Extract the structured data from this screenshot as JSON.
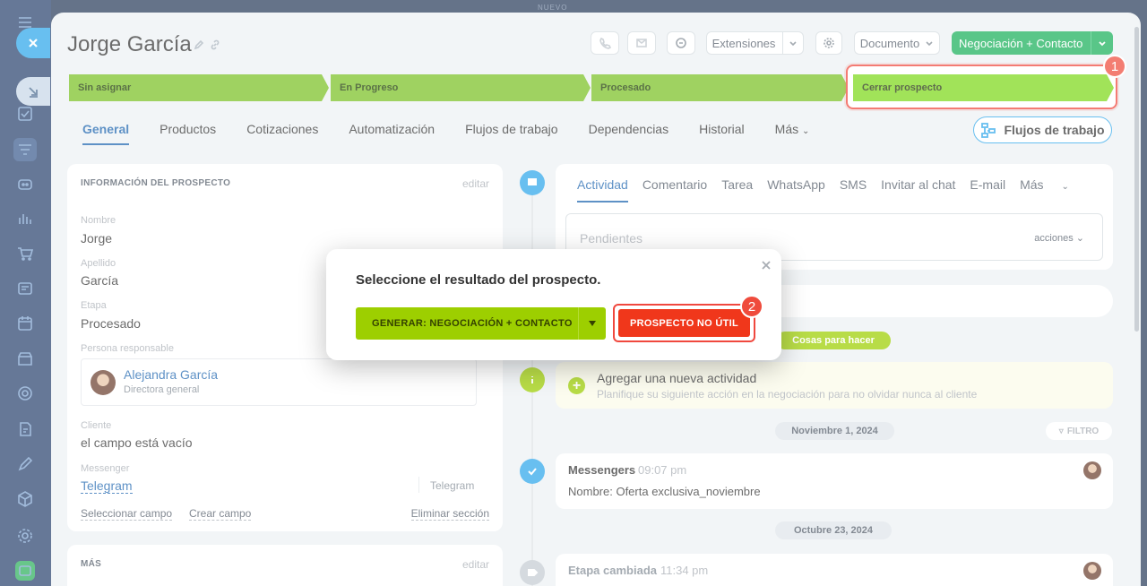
{
  "topbar": {
    "label": "NUEVO"
  },
  "header": {
    "title": "Jorge García",
    "extensions_label": "Extensiones",
    "document_label": "Documento",
    "primary_action_label": "Negociación + Contacto"
  },
  "stages": [
    {
      "label": "Sin asignar"
    },
    {
      "label": "En Progreso"
    },
    {
      "label": "Procesado"
    },
    {
      "label": "Cerrar prospecto"
    }
  ],
  "badges": {
    "one": "1",
    "two": "2"
  },
  "tabs": [
    {
      "label": "General"
    },
    {
      "label": "Productos"
    },
    {
      "label": "Cotizaciones"
    },
    {
      "label": "Automatización"
    },
    {
      "label": "Flujos de trabajo"
    },
    {
      "label": "Dependencias"
    },
    {
      "label": "Historial"
    },
    {
      "label": "Más"
    }
  ],
  "flujos_button": "Flujos de trabajo",
  "info_section": {
    "title": "INFORMACIÓN DEL PROSPECTO",
    "edit": "editar",
    "fields": {
      "nombre_label": "Nombre",
      "nombre_value": "Jorge",
      "apellido_label": "Apellido",
      "apellido_value": "García",
      "etapa_label": "Etapa",
      "etapa_value": "Procesado",
      "responsable_label": "Persona responsable",
      "responsable_name": "Alejandra García",
      "responsable_role": "Directora general",
      "cliente_label": "Cliente",
      "cliente_value": "el campo está vacío",
      "messenger_label": "Messenger",
      "messenger_value": "Telegram",
      "messenger_type": "Telegram"
    },
    "footer": {
      "select": "Seleccionar campo",
      "create": "Crear campo",
      "delete": "Eliminar sección"
    }
  },
  "more_section": {
    "title": "MÁS",
    "edit": "editar"
  },
  "activity": {
    "tabs": [
      {
        "label": "Actividad"
      },
      {
        "label": "Comentario"
      },
      {
        "label": "Tarea"
      },
      {
        "label": "WhatsApp"
      },
      {
        "label": "SMS"
      },
      {
        "label": "Invitar al chat"
      },
      {
        "label": "E-mail"
      },
      {
        "label": "Más"
      }
    ],
    "pending_placeholder": "Pendientes",
    "actions_label": "acciones"
  },
  "todo_pill": "Cosas para hacer",
  "add_activity": {
    "title": "Agregar una nueva actividad",
    "subtitle": "Planifique su siguiente acción en la negociación para no olvidar nunca al cliente"
  },
  "date1": "Noviembre 1, 2024",
  "filter_label": "FILTRO",
  "messengers_item": {
    "title": "Messengers",
    "time": "09:07 pm",
    "text": "Nombre: Oferta exclusiva_noviembre"
  },
  "date2": "Octubre 23, 2024",
  "stage_changed": {
    "title": "Etapa cambiada",
    "time": "11:34 pm"
  },
  "modal": {
    "title": "Seleccione el resultado del prospecto.",
    "generate_label": "GENERAR: NEGOCIACIÓN + CONTACTO",
    "useless_label": "PROSPECTO NO ÚTIL"
  },
  "colors": {
    "stage_green": "#7ac124",
    "accent_blue": "#2067b0",
    "danger_red": "#f0371b"
  }
}
